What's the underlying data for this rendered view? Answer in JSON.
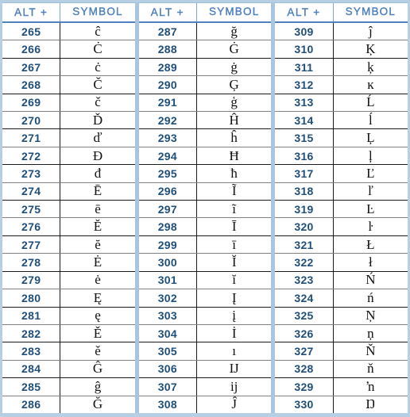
{
  "table": {
    "title": "ALT code symbol reference table",
    "colors": {
      "header_text": "#4f81bd",
      "number_text": "#1f4e79",
      "symbol_text": "#111111",
      "outer_border": "#b7cfe3",
      "group_divider": "#a9c6e0",
      "row_divider_dark": "#1a1a1a",
      "row_divider_gray": "#808080",
      "header_rule": "#4f81bd",
      "background": "#ffffff"
    },
    "headers": {
      "alt": "ALT +",
      "symbol": "SYMBOL"
    },
    "groups": [
      {
        "name": "group-1",
        "rows": [
          {
            "alt": "265",
            "symbol": "ĉ"
          },
          {
            "alt": "266",
            "symbol": "Ċ"
          },
          {
            "alt": "267",
            "symbol": "ċ"
          },
          {
            "alt": "268",
            "symbol": "Č"
          },
          {
            "alt": "269",
            "symbol": "č"
          },
          {
            "alt": "270",
            "symbol": "Ď"
          },
          {
            "alt": "271",
            "symbol": "ď"
          },
          {
            "alt": "272",
            "symbol": "Đ"
          },
          {
            "alt": "273",
            "symbol": "đ"
          },
          {
            "alt": "274",
            "symbol": "Ē"
          },
          {
            "alt": "275",
            "symbol": "ē"
          },
          {
            "alt": "276",
            "symbol": "Ĕ"
          },
          {
            "alt": "277",
            "symbol": "ĕ"
          },
          {
            "alt": "278",
            "symbol": "Ė"
          },
          {
            "alt": "279",
            "symbol": "ė"
          },
          {
            "alt": "280",
            "symbol": "Ę"
          },
          {
            "alt": "281",
            "symbol": "ę"
          },
          {
            "alt": "282",
            "symbol": "Ě"
          },
          {
            "alt": "283",
            "symbol": "ě"
          },
          {
            "alt": "284",
            "symbol": "Ĝ"
          },
          {
            "alt": "285",
            "symbol": "ĝ"
          },
          {
            "alt": "286",
            "symbol": "Ğ"
          }
        ]
      },
      {
        "name": "group-2",
        "rows": [
          {
            "alt": "287",
            "symbol": "ğ"
          },
          {
            "alt": "288",
            "symbol": "Ġ"
          },
          {
            "alt": "289",
            "symbol": "ġ"
          },
          {
            "alt": "290",
            "symbol": "Ģ"
          },
          {
            "alt": "291",
            "symbol": "ģ"
          },
          {
            "alt": "292",
            "symbol": "Ĥ"
          },
          {
            "alt": "293",
            "symbol": "ĥ"
          },
          {
            "alt": "294",
            "symbol": "Ħ"
          },
          {
            "alt": "295",
            "symbol": "ħ"
          },
          {
            "alt": "296",
            "symbol": "Ĩ"
          },
          {
            "alt": "297",
            "symbol": "ĩ"
          },
          {
            "alt": "298",
            "symbol": "Ī"
          },
          {
            "alt": "299",
            "symbol": "ī"
          },
          {
            "alt": "300",
            "symbol": "Ĭ"
          },
          {
            "alt": "301",
            "symbol": "ĭ"
          },
          {
            "alt": "302",
            "symbol": "Į"
          },
          {
            "alt": "303",
            "symbol": "į"
          },
          {
            "alt": "304",
            "symbol": "İ"
          },
          {
            "alt": "305",
            "symbol": "ı"
          },
          {
            "alt": "306",
            "symbol": "Ĳ"
          },
          {
            "alt": "307",
            "symbol": "ĳ"
          },
          {
            "alt": "308",
            "symbol": "Ĵ"
          }
        ]
      },
      {
        "name": "group-3",
        "rows": [
          {
            "alt": "309",
            "symbol": "ĵ"
          },
          {
            "alt": "310",
            "symbol": "Ķ"
          },
          {
            "alt": "311",
            "symbol": "ķ"
          },
          {
            "alt": "312",
            "symbol": "ĸ"
          },
          {
            "alt": "313",
            "symbol": "Ĺ"
          },
          {
            "alt": "314",
            "symbol": "ĺ"
          },
          {
            "alt": "315",
            "symbol": "Ļ"
          },
          {
            "alt": "316",
            "symbol": "ļ"
          },
          {
            "alt": "317",
            "symbol": "Ľ"
          },
          {
            "alt": "318",
            "symbol": "ľ"
          },
          {
            "alt": "319",
            "symbol": "Ŀ"
          },
          {
            "alt": "320",
            "symbol": "ŀ"
          },
          {
            "alt": "321",
            "symbol": "Ł"
          },
          {
            "alt": "322",
            "symbol": "ł"
          },
          {
            "alt": "323",
            "symbol": "Ń"
          },
          {
            "alt": "324",
            "symbol": "ń"
          },
          {
            "alt": "325",
            "symbol": "Ņ"
          },
          {
            "alt": "326",
            "symbol": "ņ"
          },
          {
            "alt": "327",
            "symbol": "Ň"
          },
          {
            "alt": "328",
            "symbol": "ň"
          },
          {
            "alt": "329",
            "symbol": "ŉ"
          },
          {
            "alt": "330",
            "symbol": "Ŋ"
          }
        ]
      }
    ]
  }
}
